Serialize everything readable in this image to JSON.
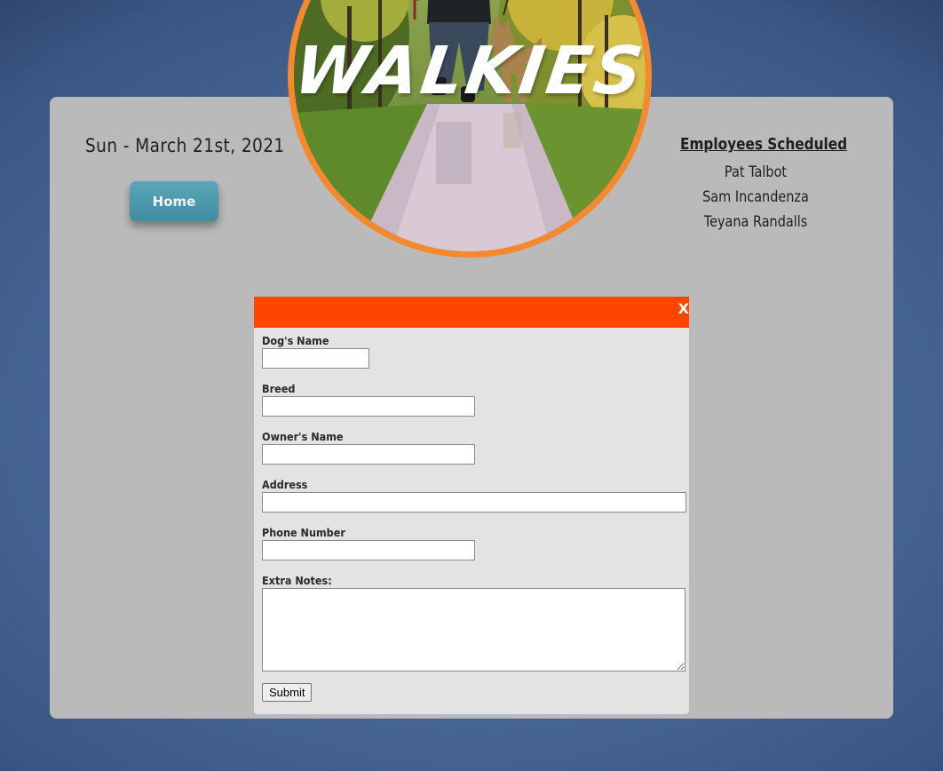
{
  "header": {
    "date": "Sun - March 21st, 2021",
    "home_label": "Home",
    "logo_text": "WALKIES"
  },
  "employees": {
    "title": "Employees Scheduled",
    "names": [
      "Pat Talbot",
      "Sam Incandenza",
      "Teyana Randalls"
    ]
  },
  "form": {
    "close_label": "X",
    "fields": {
      "dog_name": {
        "label": "Dog's Name",
        "value": ""
      },
      "breed": {
        "label": "Breed",
        "value": ""
      },
      "owner_name": {
        "label": "Owner's Name",
        "value": ""
      },
      "address": {
        "label": "Address",
        "value": ""
      },
      "phone": {
        "label": "Phone Number",
        "value": ""
      },
      "notes": {
        "label": "Extra Notes:",
        "value": ""
      }
    },
    "submit_label": "Submit"
  },
  "colors": {
    "background": "#4a6896",
    "panel": "#bababa",
    "modal_header": "#ff4600",
    "modal_body": "#e3e3e3",
    "logo_ring": "#f6882e",
    "home_button": "#4a97ab"
  }
}
